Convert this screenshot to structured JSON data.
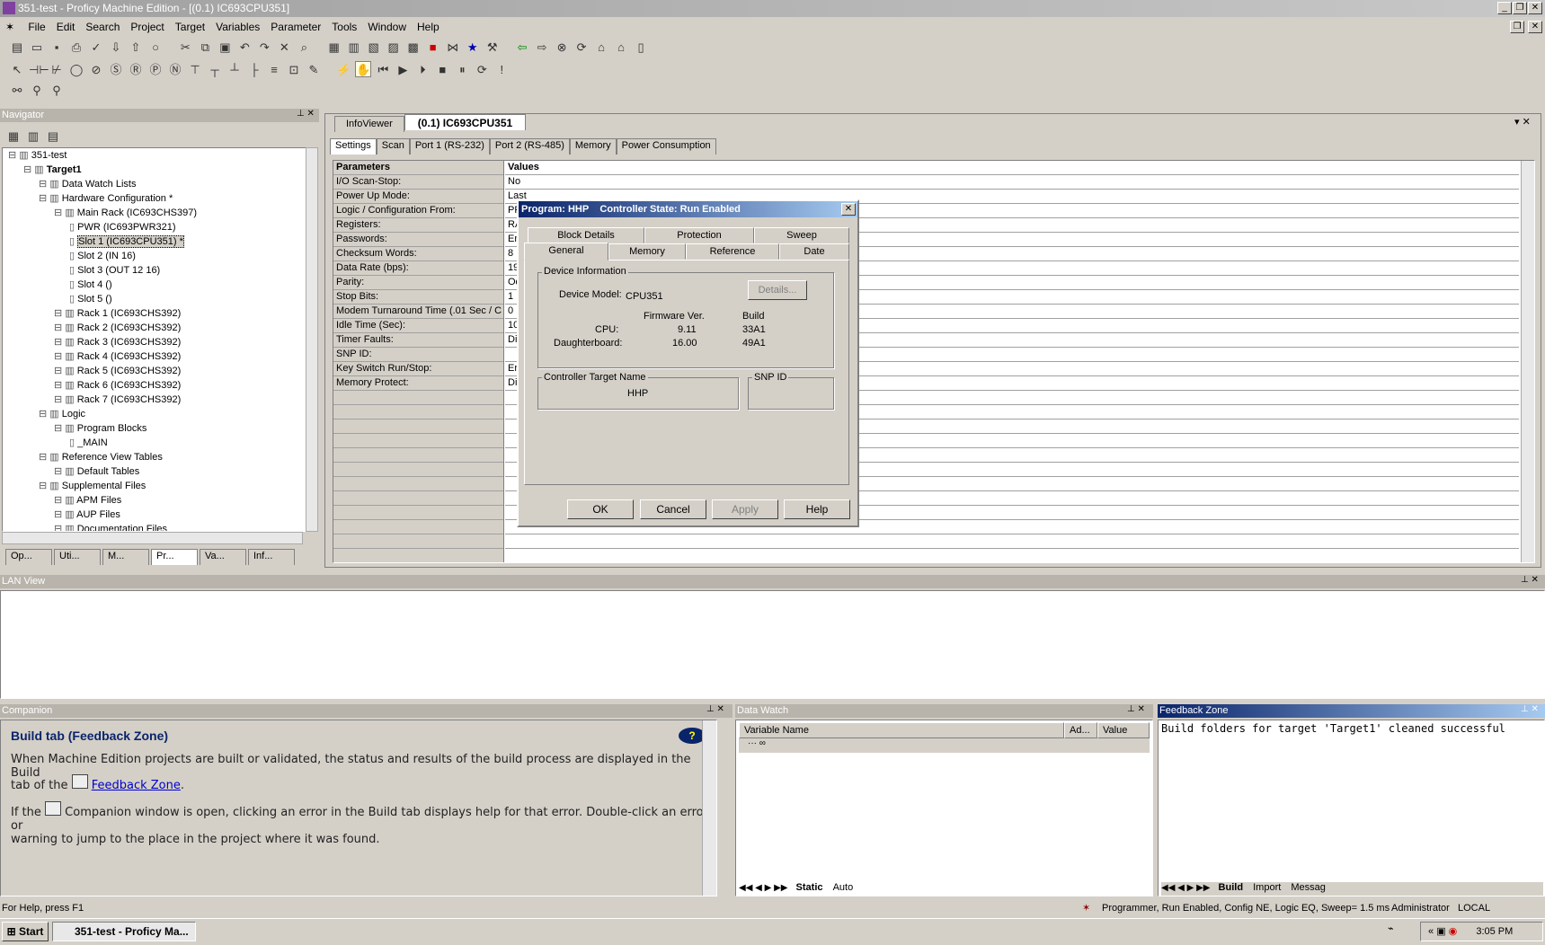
{
  "window": {
    "title": "351-test - Proficy Machine Edition - [(0.1) IC693CPU351]"
  },
  "menu": [
    "File",
    "Edit",
    "Search",
    "Project",
    "Target",
    "Variables",
    "Parameter",
    "Tools",
    "Window",
    "Help"
  ],
  "navigator": {
    "title": "Navigator",
    "tree": [
      {
        "label": "351-test",
        "lvl": 0
      },
      {
        "label": "Target1",
        "lvl": 1,
        "bold": true
      },
      {
        "label": "Data Watch Lists",
        "lvl": 2
      },
      {
        "label": "Hardware Configuration *",
        "lvl": 2
      },
      {
        "label": "Main Rack (IC693CHS397)",
        "lvl": 3
      },
      {
        "label": "PWR (IC693PWR321)",
        "lvl": 4
      },
      {
        "label": "Slot 1 (IC693CPU351) *",
        "lvl": 4,
        "selected": true
      },
      {
        "label": "Slot 2 (IN 16)",
        "lvl": 4
      },
      {
        "label": "Slot 3 (OUT 12 16)",
        "lvl": 4
      },
      {
        "label": "Slot 4 ()",
        "lvl": 4
      },
      {
        "label": "Slot 5 ()",
        "lvl": 4
      },
      {
        "label": "Rack 1 (IC693CHS392)",
        "lvl": 3
      },
      {
        "label": "Rack 2 (IC693CHS392)",
        "lvl": 3
      },
      {
        "label": "Rack 3 (IC693CHS392)",
        "lvl": 3
      },
      {
        "label": "Rack 4 (IC693CHS392)",
        "lvl": 3
      },
      {
        "label": "Rack 5 (IC693CHS392)",
        "lvl": 3
      },
      {
        "label": "Rack 6 (IC693CHS392)",
        "lvl": 3
      },
      {
        "label": "Rack 7 (IC693CHS392)",
        "lvl": 3
      },
      {
        "label": "Logic",
        "lvl": 2
      },
      {
        "label": "Program Blocks",
        "lvl": 3
      },
      {
        "label": "_MAIN",
        "lvl": 4
      },
      {
        "label": "Reference View Tables",
        "lvl": 2
      },
      {
        "label": "Default Tables",
        "lvl": 3
      },
      {
        "label": "Supplemental Files",
        "lvl": 2
      },
      {
        "label": "APM Files",
        "lvl": 3
      },
      {
        "label": "AUP Files",
        "lvl": 3
      },
      {
        "label": "Documentation Files",
        "lvl": 3
      }
    ],
    "tabs": [
      "Op...",
      "Uti...",
      "M...",
      "Pr...",
      "Va...",
      "Inf..."
    ]
  },
  "doc_tabs": [
    "InfoViewer",
    "(0.1) IC693CPU351"
  ],
  "config_tabs": [
    "Settings",
    "Scan",
    "Port 1 (RS-232)",
    "Port 2 (RS-485)",
    "Memory",
    "Power Consumption"
  ],
  "grid": {
    "col_params": "Parameters",
    "col_values": "Values",
    "rows": [
      [
        "I/O Scan-Stop:",
        "No"
      ],
      [
        "Power Up Mode:",
        "Last"
      ],
      [
        "Logic / Configuration From:",
        "PF"
      ],
      [
        "Registers:",
        "RA"
      ],
      [
        "Passwords:",
        "En"
      ],
      [
        "Checksum Words:",
        "8"
      ],
      [
        "Data Rate (bps):",
        "19"
      ],
      [
        "Parity:",
        "Od"
      ],
      [
        "Stop Bits:",
        "1"
      ],
      [
        "Modem Turnaround Time (.01 Sec / C",
        "0"
      ],
      [
        "Idle Time (Sec):",
        "10"
      ],
      [
        "Timer Faults:",
        "Dis"
      ],
      [
        "SNP ID:",
        ""
      ],
      [
        "Key Switch Run/Stop:",
        "Er"
      ],
      [
        "Memory Protect:",
        "Dis"
      ]
    ]
  },
  "dialog": {
    "title_prog": "Program: HHP",
    "title_state": "Controller State: Run Enabled",
    "tabs_top": [
      "Block Details",
      "Protection",
      "Sweep"
    ],
    "tabs_bottom": [
      "General",
      "Memory",
      "Reference",
      "Date"
    ],
    "device_info": "Device Information",
    "device_model_label": "Device Model:",
    "device_model": "CPU351",
    "details_btn": "Details...",
    "fw_header": "Firmware Ver.",
    "build_header": "Build",
    "cpu_label": "CPU:",
    "cpu_fw": "9.11",
    "cpu_build": "33A1",
    "db_label": "Daughterboard:",
    "db_fw": "16.00",
    "db_build": "49A1",
    "target_name_label": "Controller Target Name",
    "target_name": "HHP",
    "snp_label": "SNP ID",
    "ok": "OK",
    "cancel": "Cancel",
    "apply": "Apply",
    "help": "Help"
  },
  "lan": {
    "title": "LAN View"
  },
  "companion": {
    "title": "Companion",
    "heading": "Build tab (Feedback Zone)",
    "p1a": "When Machine Edition projects are built or validated, the status and results of the build process are displayed in the Build",
    "p1b": "tab of the",
    "link": "Feedback Zone",
    "p1c": ".",
    "p2a": "If the",
    "p2b": "Companion window is open, clicking an error in the Build tab displays help for that error. Double-click an error or",
    "p2c": "warning to jump to the place in the project where it was found."
  },
  "datawatch": {
    "title": "Data Watch",
    "cols": [
      "Variable Name",
      "Ad...",
      "Value"
    ],
    "tabs": [
      "Static",
      "Auto"
    ]
  },
  "feedback": {
    "title": "Feedback Zone",
    "text": "Build folders for target 'Target1' cleaned successful",
    "tabs": [
      "Build",
      "Import",
      "Messag"
    ]
  },
  "status": {
    "help": "For Help, press F1",
    "state": "Programmer, Run Enabled, Config NE, Logic EQ, Sweep= 1.5 ms",
    "user": "Administrator",
    "mode": "LOCAL"
  },
  "taskbar": {
    "start": "Start",
    "task": "351-test - Proficy Ma...",
    "clock": "3:05 PM"
  }
}
